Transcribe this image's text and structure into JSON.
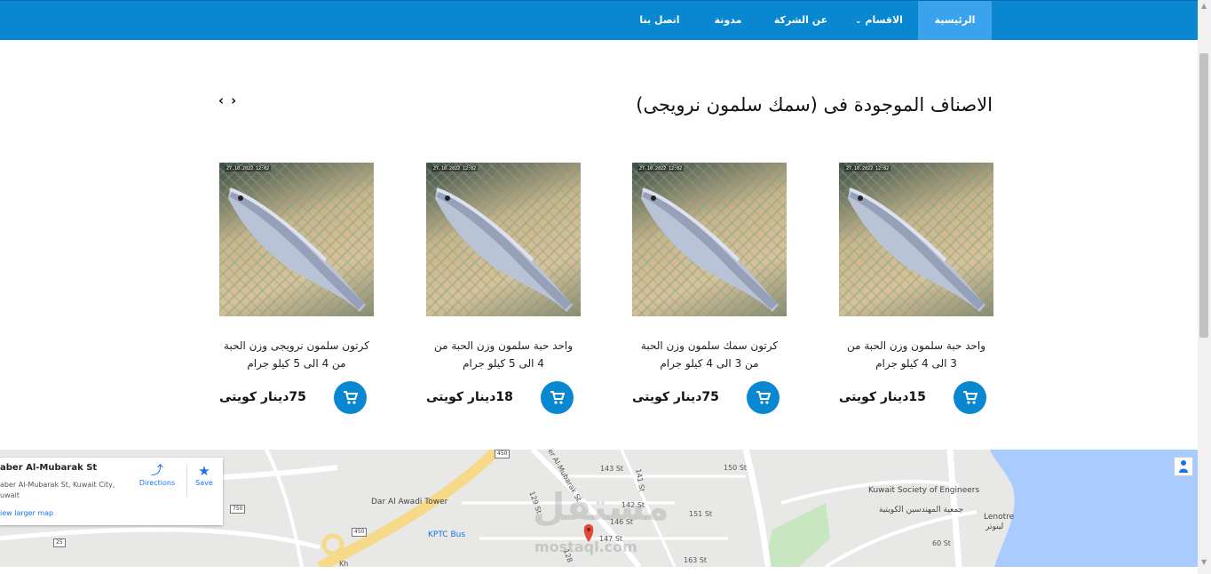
{
  "nav": {
    "items": [
      {
        "label": "الرئيسية"
      },
      {
        "label": "الاقسام"
      },
      {
        "label": "عن الشركة"
      },
      {
        "label": "مدونة"
      },
      {
        "label": "اتصل بنا"
      }
    ]
  },
  "section": {
    "title": "الاصناف الموجودة فى (سمك سلمون نرويجى)",
    "prev_arrow": "‹",
    "next_arrow": "›"
  },
  "products": [
    {
      "description": "واحد حبة سلمون وزن الحبة من 3 الى 4 كيلو جرام",
      "price": "15دينار كويتى"
    },
    {
      "description": "كرتون سمك سلمون وزن الحبة من 3 الى 4 كيلو جرام",
      "price": "75دينار كويتى"
    },
    {
      "description": "واحد حبة سلمون وزن الحبة من 4 الى 5 كيلو جرام",
      "price": "18دينار كويتى"
    },
    {
      "description": "كرتون سلمون نرويجى وزن الحبة من 4 الى 5 كيلو جرام",
      "price": "75دينار كويتى"
    }
  ],
  "map": {
    "place_name": "aber Al-Mubarak St",
    "place_address": "aber Al-Mubarak St, Kuwait City, uwait",
    "directions_label": "Directions",
    "save_label": "Save",
    "larger_map_label": "iew larger map",
    "streets": [
      "143 St",
      "142 St",
      "146 St",
      "147 St",
      "150 St",
      "151 St",
      "163 St",
      "60 St",
      "129 St",
      "141 St",
      "128",
      "aber Al-Mubarak St",
      "Kh"
    ],
    "pois": [
      "Dar Al Awadi Tower",
      "KPTC Bus",
      "Kuwait Society of Engineers",
      "جمعية المهندسين الكويتية",
      "Lenotre",
      "لينوتر"
    ],
    "shields": [
      "450",
      "750",
      "450",
      "25"
    ],
    "watermark": "مستقل",
    "watermark_sub": "mostaql.com"
  },
  "colors": {
    "nav_bg": "#0a87d1",
    "nav_active": "#3ba3ee",
    "cart_button": "#0a87d1"
  }
}
